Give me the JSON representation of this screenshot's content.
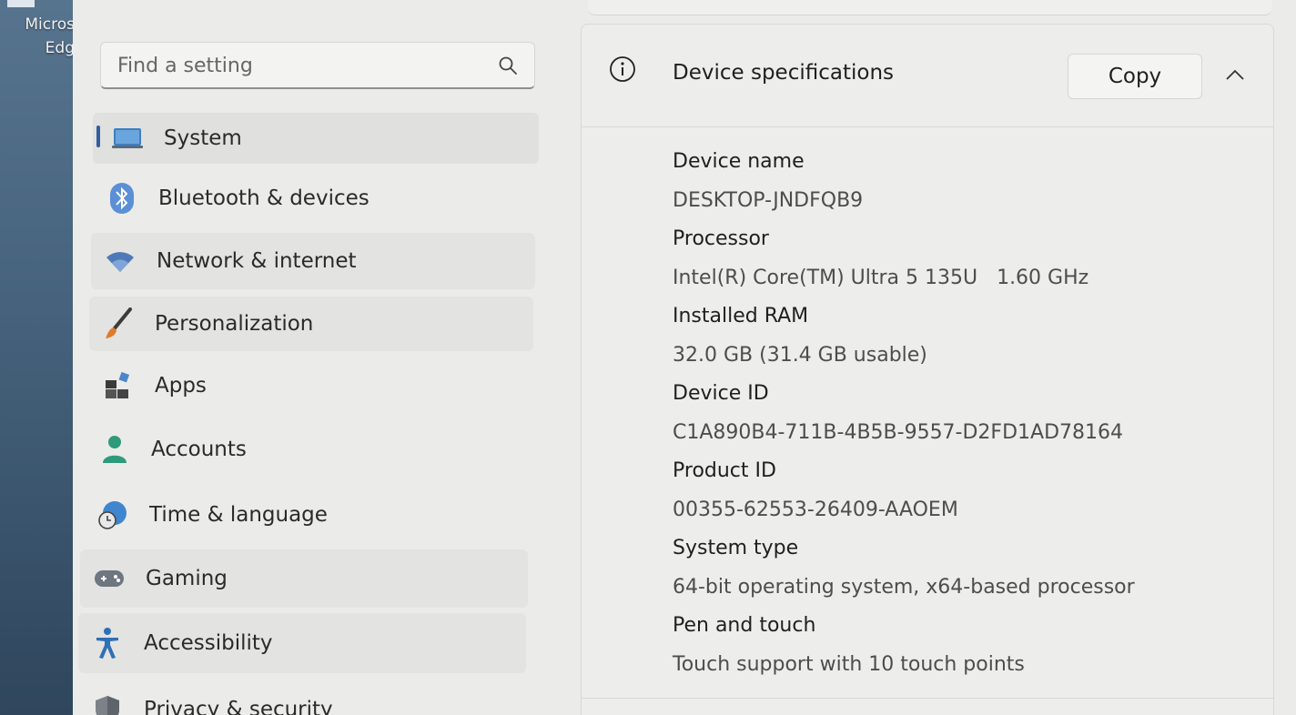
{
  "desktop": {
    "icon_label_line1": "Micros",
    "icon_label_line2": "Edg"
  },
  "search": {
    "placeholder": "Find a setting"
  },
  "sidebar": {
    "items": [
      {
        "label": "System",
        "icon": "laptop-icon",
        "active": true
      },
      {
        "label": "Bluetooth & devices",
        "icon": "bluetooth-icon"
      },
      {
        "label": "Network & internet",
        "icon": "wifi-icon"
      },
      {
        "label": "Personalization",
        "icon": "brush-icon"
      },
      {
        "label": "Apps",
        "icon": "apps-icon"
      },
      {
        "label": "Accounts",
        "icon": "person-icon"
      },
      {
        "label": "Time & language",
        "icon": "globe-clock-icon"
      },
      {
        "label": "Gaming",
        "icon": "gamepad-icon"
      },
      {
        "label": "Accessibility",
        "icon": "accessibility-icon"
      },
      {
        "label": "Privacy & security",
        "icon": "shield-icon"
      }
    ]
  },
  "device_specs": {
    "title": "Device specifications",
    "copy_label": "Copy",
    "rows": [
      {
        "label": "Device name",
        "value": "DESKTOP-JNDFQB9"
      },
      {
        "label": "Processor",
        "value": "Intel(R) Core(TM) Ultra 5 135U   1.60 GHz"
      },
      {
        "label": "Installed RAM",
        "value": "32.0 GB (31.4 GB usable)"
      },
      {
        "label": "Device ID",
        "value": "C1A890B4-711B-4B5B-9557-D2FD1AD78164"
      },
      {
        "label": "Product ID",
        "value": "00355-62553-26409-AAOEM"
      },
      {
        "label": "System type",
        "value": "64-bit operating system, x64-based processor"
      },
      {
        "label": "Pen and touch",
        "value": "Touch support with 10 touch points"
      }
    ]
  },
  "colors": {
    "accent": "#2f5f9e",
    "window_bg": "#ebebea",
    "text_primary": "#1f1f1f",
    "text_secondary": "#4d4d4d"
  }
}
